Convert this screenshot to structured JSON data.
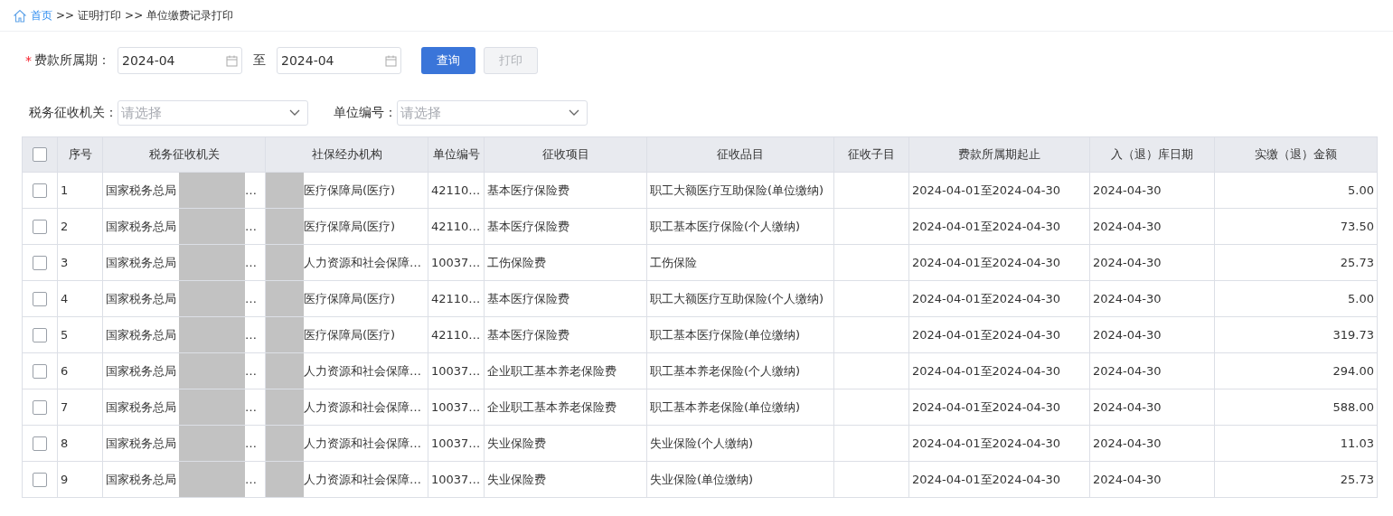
{
  "breadcrumb": [
    {
      "label": "首页",
      "link": true
    },
    {
      "label": ">>",
      "link": false
    },
    {
      "label": "证明打印",
      "link": false
    },
    {
      "label": ">>",
      "link": false
    },
    {
      "label": "单位缴费记录打印",
      "link": false
    }
  ],
  "filters": {
    "period_label": "费款所属期：",
    "required_mark": "*",
    "period_from": "2024-04",
    "to_label": "至",
    "period_to": "2024-04",
    "query_button": "查询",
    "print_button": {
      "label": "打印",
      "disabled": true
    },
    "tax_office_label": "税务征收机关：",
    "tax_office_placeholder": "请选择",
    "unit_label": "单位编号：",
    "unit_placeholder": "请选择"
  },
  "table": {
    "select_all": false,
    "columns": [
      "序号",
      "税务征收机关",
      "社保经办机构",
      "单位编号",
      "征收项目",
      "征收品目",
      "征收子目",
      "费款所属期起止",
      "入（退）库日期",
      "实缴（退）金额"
    ],
    "rows": [
      {
        "checked": false,
        "no": "1",
        "tax_office": "国家税务总局",
        "tax_office_tail": "…",
        "agency": "医疗保障局(医疗)",
        "unit": "42110…",
        "item": "基本医疗保险费",
        "category": "职工大额医疗互助保险(单位缴纳)",
        "period": "2024-04-01至2024-04-30",
        "date": "2024-04-30",
        "amount": "5.00"
      },
      {
        "checked": false,
        "no": "2",
        "tax_office": "国家税务总局",
        "tax_office_tail": "…",
        "agency": "医疗保障局(医疗)",
        "unit": "42110…",
        "item": "基本医疗保险费",
        "category": "职工基本医疗保险(个人缴纳)",
        "period": "2024-04-01至2024-04-30",
        "date": "2024-04-30",
        "amount": "73.50"
      },
      {
        "checked": false,
        "no": "3",
        "tax_office": "国家税务总局",
        "tax_office_tail": "…",
        "agency": "人力资源和社会保障…",
        "unit": "10037…",
        "item": "工伤保险费",
        "category": "工伤保险",
        "period": "2024-04-01至2024-04-30",
        "date": "2024-04-30",
        "amount": "25.73"
      },
      {
        "checked": false,
        "no": "4",
        "tax_office": "国家税务总局",
        "tax_office_tail": "…",
        "agency": "医疗保障局(医疗)",
        "unit": "42110…",
        "item": "基本医疗保险费",
        "category": "职工大额医疗互助保险(个人缴纳)",
        "period": "2024-04-01至2024-04-30",
        "date": "2024-04-30",
        "amount": "5.00"
      },
      {
        "checked": false,
        "no": "5",
        "tax_office": "国家税务总局",
        "tax_office_tail": "…",
        "agency": "医疗保障局(医疗)",
        "unit": "42110…",
        "item": "基本医疗保险费",
        "category": "职工基本医疗保险(单位缴纳)",
        "period": "2024-04-01至2024-04-30",
        "date": "2024-04-30",
        "amount": "319.73"
      },
      {
        "checked": false,
        "no": "6",
        "tax_office": "国家税务总局",
        "tax_office_tail": "…",
        "agency": "人力资源和社会保障…",
        "unit": "10037…",
        "item": "企业职工基本养老保险费",
        "category": "职工基本养老保险(个人缴纳)",
        "period": "2024-04-01至2024-04-30",
        "date": "2024-04-30",
        "amount": "294.00"
      },
      {
        "checked": false,
        "no": "7",
        "tax_office": "国家税务总局",
        "tax_office_tail": "…",
        "agency": "人力资源和社会保障…",
        "unit": "10037…",
        "item": "企业职工基本养老保险费",
        "category": "职工基本养老保险(单位缴纳)",
        "period": "2024-04-01至2024-04-30",
        "date": "2024-04-30",
        "amount": "588.00"
      },
      {
        "checked": false,
        "no": "8",
        "tax_office": "国家税务总局",
        "tax_office_tail": "…",
        "agency": "人力资源和社会保障…",
        "unit": "10037…",
        "item": "失业保险费",
        "category": "失业保险(个人缴纳)",
        "period": "2024-04-01至2024-04-30",
        "date": "2024-04-30",
        "amount": "11.03"
      },
      {
        "checked": false,
        "no": "9",
        "tax_office": "国家税务总局",
        "tax_office_tail": "…",
        "agency": "人力资源和社会保障…",
        "unit": "10037…",
        "item": "失业保险费",
        "category": "失业保险(单位缴纳)",
        "period": "2024-04-01至2024-04-30",
        "date": "2024-04-30",
        "amount": "25.73"
      }
    ]
  }
}
